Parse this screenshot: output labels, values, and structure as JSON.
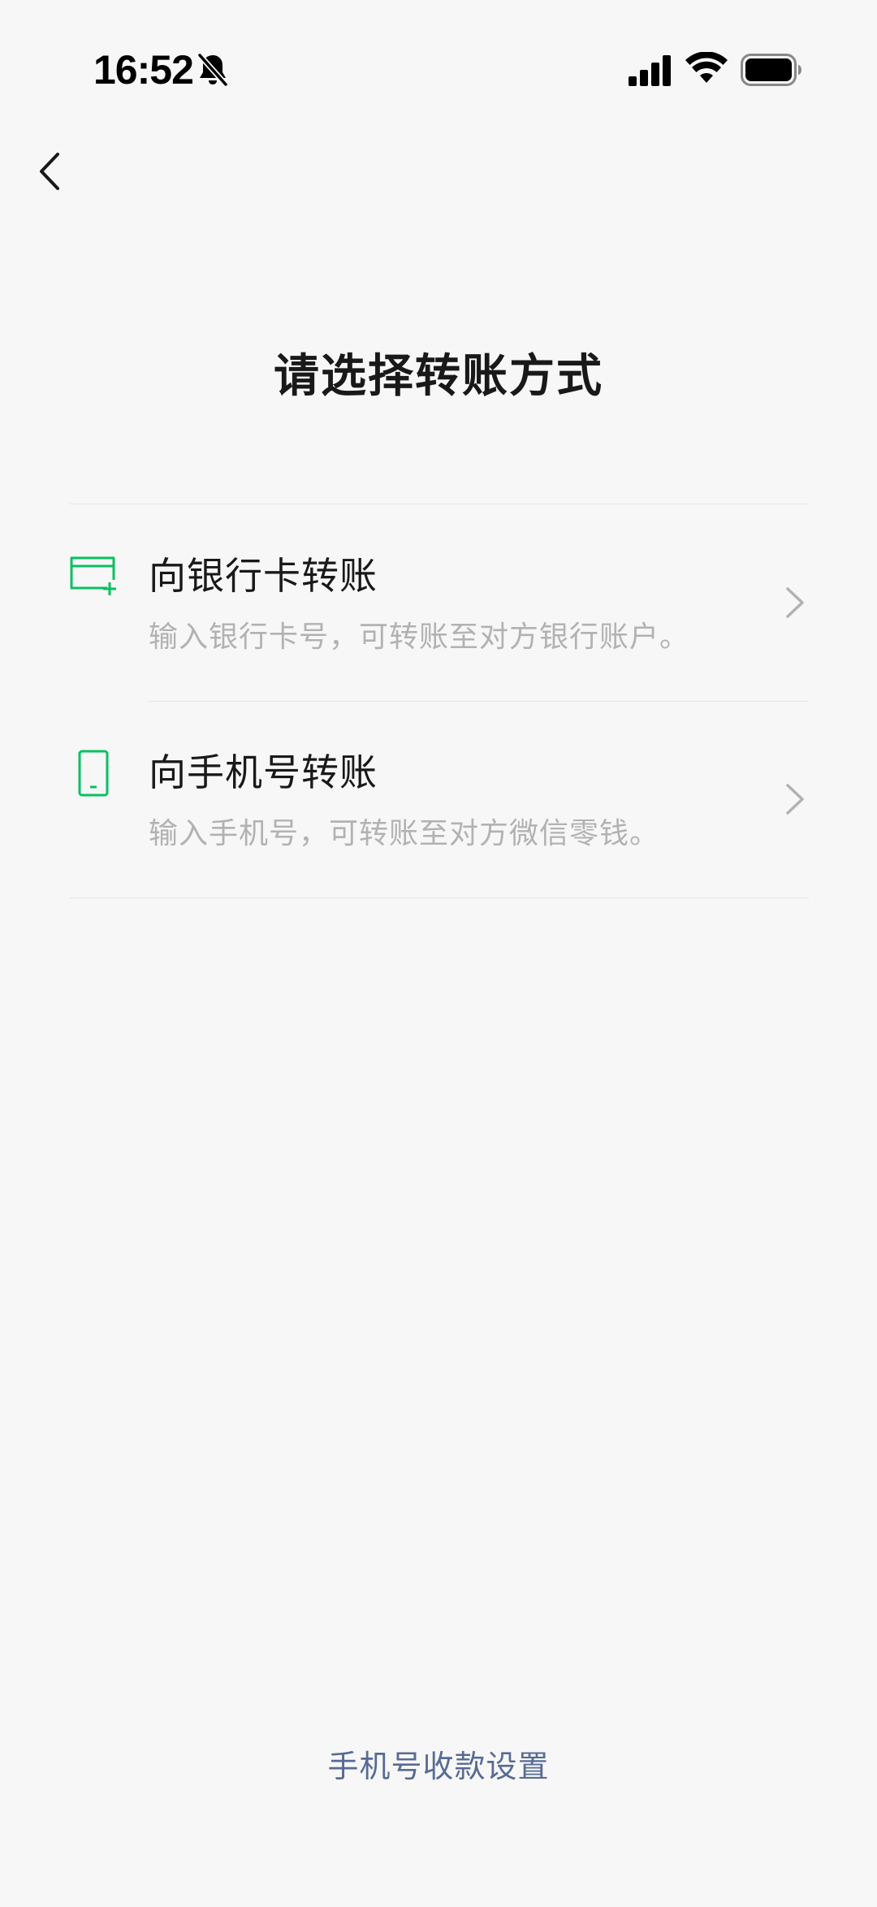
{
  "status_bar": {
    "time": "16:52",
    "icons": [
      "bell-off-icon",
      "signal-icon",
      "wifi-icon",
      "battery-icon"
    ]
  },
  "nav": {
    "back_icon": "chevron-left-icon"
  },
  "page": {
    "title": "请选择转账方式"
  },
  "options": [
    {
      "icon": "bank-card-icon",
      "title": "向银行卡转账",
      "description": "输入银行卡号，可转账至对方银行账户。"
    },
    {
      "icon": "phone-icon",
      "title": "向手机号转账",
      "description": "输入手机号，可转账至对方微信零钱。"
    }
  ],
  "footer": {
    "link_label": "手机号收款设置"
  },
  "colors": {
    "accent_green": "#07c160",
    "link_blue": "#576b95",
    "background": "#f7f7f7",
    "secondary_text": "#b2b2b2"
  }
}
